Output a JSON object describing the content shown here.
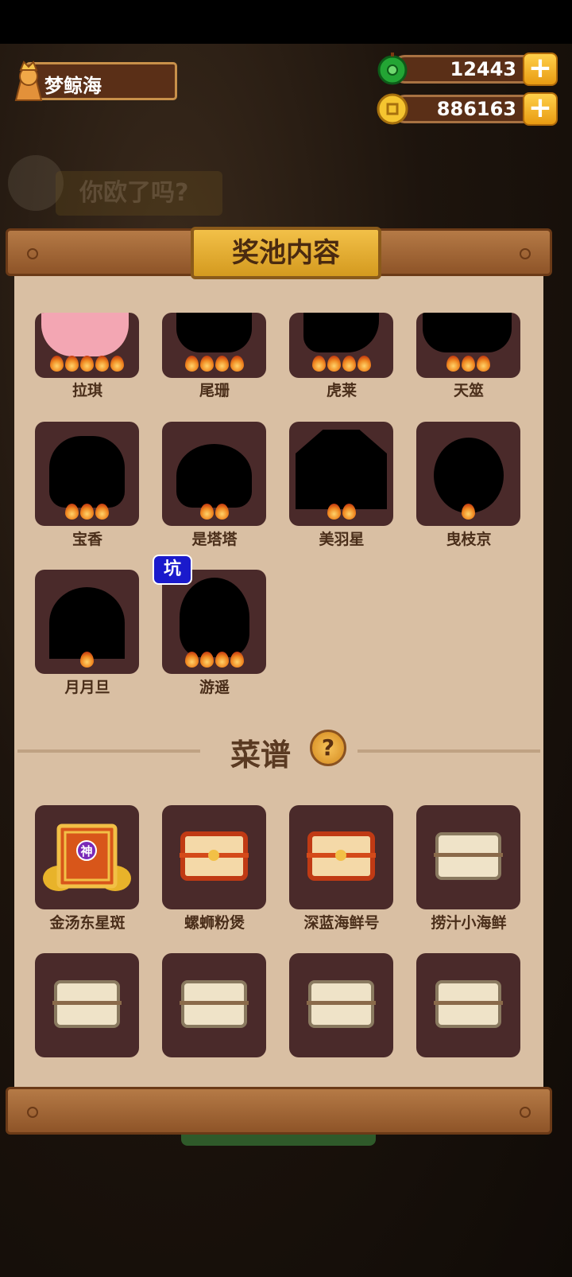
{
  "player": {
    "name": "梦鲸海"
  },
  "resources": {
    "jade": "12443",
    "coins": "886163",
    "plus_label": "+"
  },
  "background_text": "你欧了吗?",
  "pool_title": "奖池内容",
  "characters": [
    {
      "name": "拉琪",
      "stars": 5,
      "revealed": true
    },
    {
      "name": "尾珊",
      "stars": 4
    },
    {
      "name": "虎莱",
      "stars": 4
    },
    {
      "name": "天筮",
      "stars": 3
    },
    {
      "name": "宝香",
      "stars": 3
    },
    {
      "name": "是塔塔",
      "stars": 2
    },
    {
      "name": "美羽星",
      "stars": 2
    },
    {
      "name": "曳枝京",
      "stars": 1
    },
    {
      "name": "月月旦",
      "stars": 1
    },
    {
      "name": "游遥",
      "stars": 4,
      "tag": "坑"
    }
  ],
  "recipes_title": "菜谱",
  "help_label": "?",
  "recipes": [
    {
      "name": "金汤东星斑",
      "kind": "divine",
      "badge": "神"
    },
    {
      "name": "螺蛳粉煲",
      "kind": "red"
    },
    {
      "name": "深蓝海鲜号",
      "kind": "red"
    },
    {
      "name": "捞汁小海鲜",
      "kind": "plain"
    },
    {
      "name": "",
      "kind": "plain"
    },
    {
      "name": "",
      "kind": "plain"
    },
    {
      "name": "",
      "kind": "plain"
    },
    {
      "name": "",
      "kind": "plain"
    }
  ],
  "colors": {
    "panel": "#d9bfa3",
    "card": "#4a2a2a",
    "wood": "#a36a37",
    "gold": "#e9b232",
    "tag": "#1a1acc"
  }
}
